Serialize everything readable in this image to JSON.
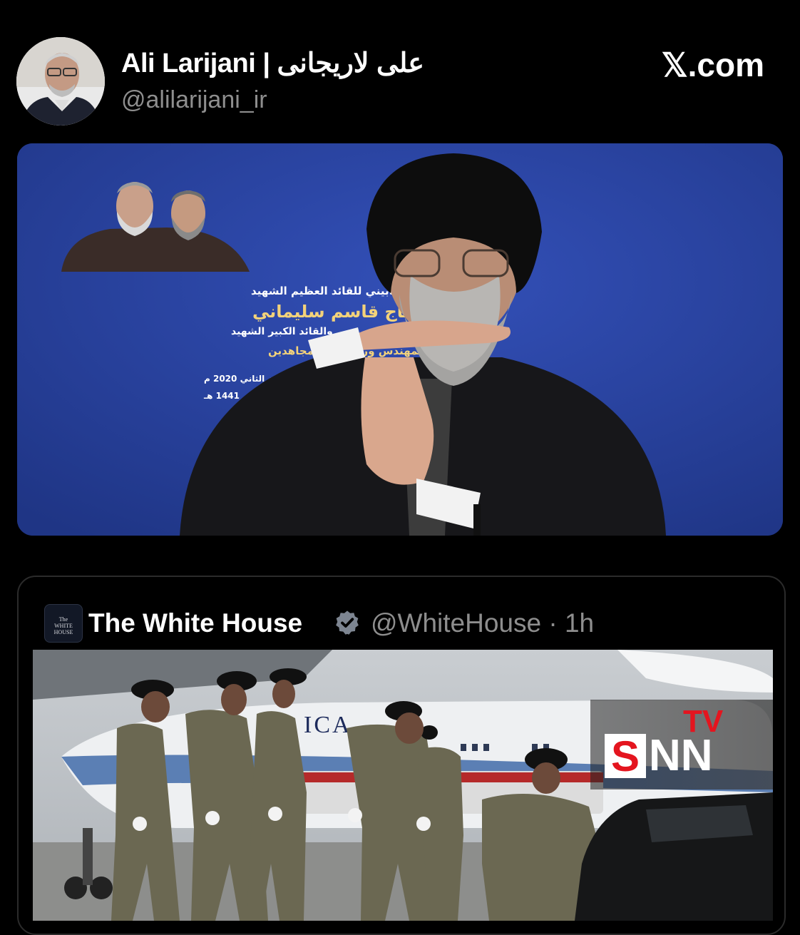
{
  "post": {
    "author": {
      "display_name": "Ali Larijani | علی لاریجانی",
      "handle": "@alilarijani_ir",
      "avatar_icon": "person-portrait-avatar"
    },
    "brand_label": "𝕏.com",
    "media_1": {
      "poster_lines": [
        "الحفل التأبيني للقائد العظيم الشهيد",
        "الحاج قاسم سليماني",
        "والقائد الكبير الشهيد",
        "أبو مهدي المهندس ورفاقهما المجاهدين",
        "٥ كانون الثاني 2020 م",
        "جمادى الأولى 1441 هـ"
      ]
    }
  },
  "quoted_post": {
    "avatar_text": "The\nWHITE\nHOUSE",
    "display_name": "The White House",
    "verified_icon": "verified-check-icon",
    "handle_time": "@WhiteHouse · 1h",
    "media": {
      "plane_lettering": "ICA",
      "watermark": {
        "tv": "TV",
        "s": "S",
        "nn": "NN"
      }
    }
  },
  "colors": {
    "background": "#000000",
    "muted_text": "#8e8e8e",
    "poster_blue": "#2a44a3",
    "verified_badge": "#7d8591",
    "snn_red": "#e4151f"
  }
}
